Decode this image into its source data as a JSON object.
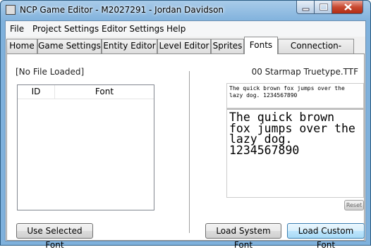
{
  "window": {
    "title": "NCP Game Editor - M2027291 - Jordan Davidson"
  },
  "menu": [
    "File",
    "Project Settings",
    "Editor Settings",
    "Help"
  ],
  "tabs": [
    "Home",
    "Game Settings",
    "Entity Editor",
    "Level Editor",
    "Sprites",
    "Fonts",
    "Connection-MOVE"
  ],
  "active_tab": "Fonts",
  "fonts_panel": {
    "file_status": "[No File Loaded]",
    "list_headers": {
      "id": "ID",
      "font": "Font"
    },
    "use_button": "Use Selected Font",
    "selected_font_file": "00 Starmap Truetype.TTF",
    "preview_small": "The quick brown fox jumps over the lazy dog. 1234567890",
    "preview_large": "The quick brown fox jumps over the lazy dog. 1234567890",
    "reset_button": "Reset",
    "load_system_button": "Load System Font",
    "load_custom_button": "Load Custom Font"
  },
  "colors": {
    "title_bar": "#7fb1dc",
    "close": "#c84a32",
    "focus_border": "#3c7fb1"
  }
}
